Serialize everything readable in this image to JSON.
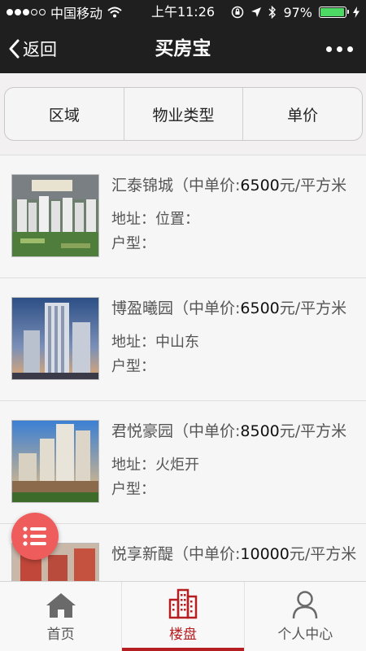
{
  "status_bar": {
    "carrier": "中国移动",
    "time": "上午11:26",
    "battery": "97%",
    "battery_level": 0.97
  },
  "nav": {
    "back_label": "返回",
    "title": "买房宝"
  },
  "filters": [
    {
      "label": "区域"
    },
    {
      "label": "物业类型"
    },
    {
      "label": "单价"
    }
  ],
  "listings": [
    {
      "name": "汇泰锦城",
      "price_prefix": "（中单价:",
      "price": "6500",
      "price_unit": "元/平方米",
      "address": "地址：位置：",
      "type": "户型：",
      "thumb_icon": "building-photo-1"
    },
    {
      "name": "博盈曦园",
      "price_prefix": "（中单价:",
      "price": "6500",
      "price_unit": "元/平方米",
      "address": "地址：中山东",
      "type": "户型：",
      "thumb_icon": "building-photo-2"
    },
    {
      "name": "君悦豪园",
      "price_prefix": "（中单价:",
      "price": "8500",
      "price_unit": "元/平方米",
      "address": "地址：火炬开",
      "type": "户型：",
      "thumb_icon": "building-photo-3"
    },
    {
      "name": "悦享新醍",
      "price_prefix": "（中单价:",
      "price": "10000",
      "price_unit": "元/平方米",
      "address": "",
      "type": "",
      "thumb_icon": "building-photo-4"
    }
  ],
  "tabs": [
    {
      "label": "首页",
      "icon": "home-icon"
    },
    {
      "label": "楼盘",
      "icon": "buildings-icon"
    },
    {
      "label": "个人中心",
      "icon": "person-icon"
    }
  ],
  "colors": {
    "header_bg": "#1f1f1f",
    "accent": "#b51f22",
    "fab": "#ef5c5c",
    "battery_fill": "#4cd964"
  }
}
